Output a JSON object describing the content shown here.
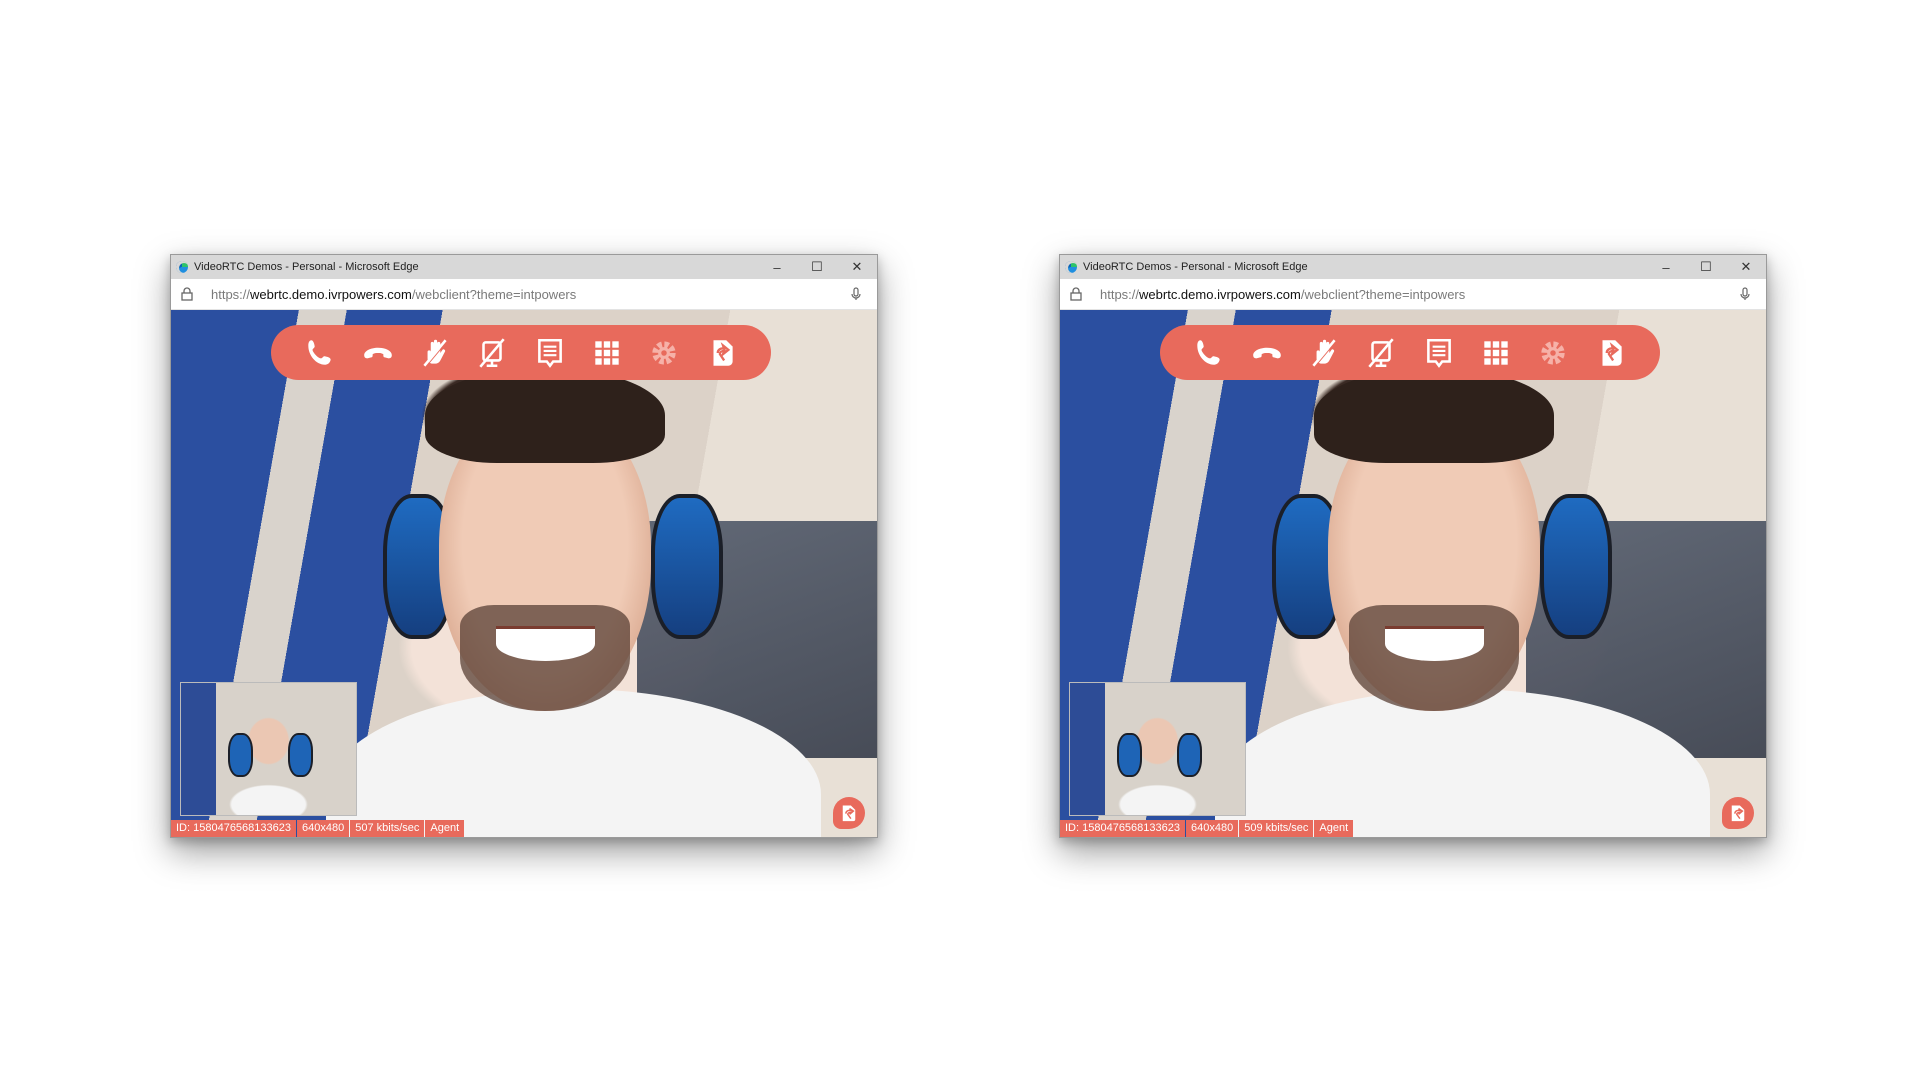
{
  "windows": [
    {
      "title": "VideoRTC Demos - Personal - Microsoft Edge",
      "url_scheme": "https://",
      "url_host": "webrtc.demo.ivrpowers.com",
      "url_path": "/webclient?theme=intpowers",
      "status": {
        "id": "ID: 1580476568133623",
        "resolution": "640x480",
        "bitrate": "507 kbits/sec",
        "role": "Agent"
      }
    },
    {
      "title": "VideoRTC Demos - Personal - Microsoft Edge",
      "url_scheme": "https://",
      "url_host": "webrtc.demo.ivrpowers.com",
      "url_path": "/webclient?theme=intpowers",
      "status": {
        "id": "ID: 1580476568133623",
        "resolution": "640x480",
        "bitrate": "509 kbits/sec",
        "role": "Agent"
      }
    }
  ],
  "window_controls": {
    "minimize": "–",
    "maximize": "☐",
    "close": "✕"
  },
  "toolbar_icons": [
    "call-icon",
    "hangup-icon",
    "hand-muted-icon",
    "video-muted-icon",
    "chat-icon",
    "dialpad-icon",
    "settings-icon",
    "logo-icon"
  ],
  "colors": {
    "accent": "#e86a5c",
    "titlebar": "#d8d8d8"
  }
}
